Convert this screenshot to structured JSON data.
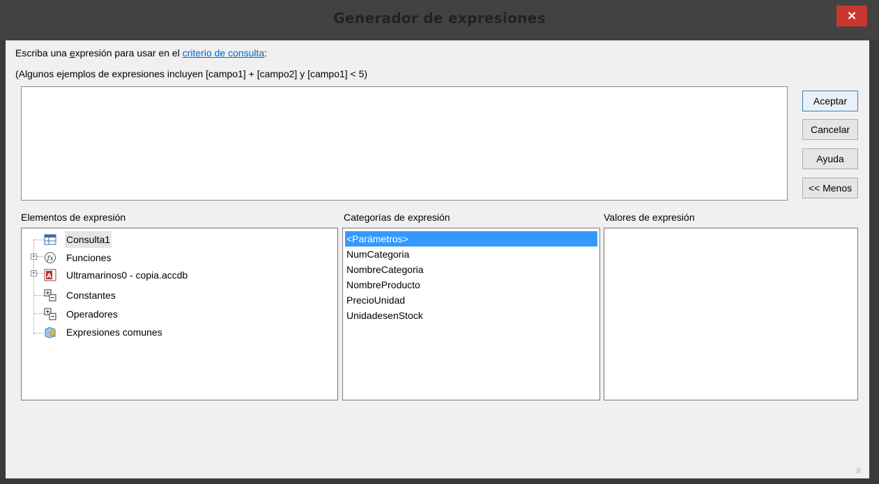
{
  "window": {
    "title": "Generador de expresiones",
    "close_label": "×"
  },
  "prompt": {
    "prefix": "Escriba una ",
    "underlined": "e",
    "mid": "xpresión para usar en el ",
    "link": "criterio de consulta",
    "suffix": ":",
    "examples": "(Algunos ejemplos de expresiones incluyen [campo1] + [campo2] y [campo1] < 5)"
  },
  "expression": {
    "value": ""
  },
  "buttons": {
    "ok": "Aceptar",
    "cancel": "Cancelar",
    "help": "Ayuda",
    "less": "<< Menos"
  },
  "elements": {
    "label": "Elementos de expresión",
    "items": [
      {
        "label": "Consulta1",
        "icon": "query-icon",
        "expandable": false,
        "selected": true
      },
      {
        "label": "Funciones",
        "icon": "function-icon",
        "expandable": true
      },
      {
        "label": "Ultramarinos0 - copia.accdb",
        "icon": "access-database-icon",
        "expandable": true
      },
      {
        "label": "Constantes",
        "icon": "constants-icon",
        "expandable": false
      },
      {
        "label": "Operadores",
        "icon": "operators-icon",
        "expandable": false
      },
      {
        "label": "Expresiones comunes",
        "icon": "common-expressions-icon",
        "expandable": false
      }
    ]
  },
  "categories": {
    "label": "Categorías de expresión",
    "items": [
      "<Parámetros>",
      "NumCategoria",
      "NombreCategoria",
      "NombreProducto",
      "PrecioUnidad",
      "UnidadesenStock"
    ],
    "selected_index": 0
  },
  "values": {
    "label": "Valores de expresión",
    "items": []
  },
  "colors": {
    "selection": "#3399ff",
    "close_button": "#c8372d",
    "link": "#0066cc"
  }
}
